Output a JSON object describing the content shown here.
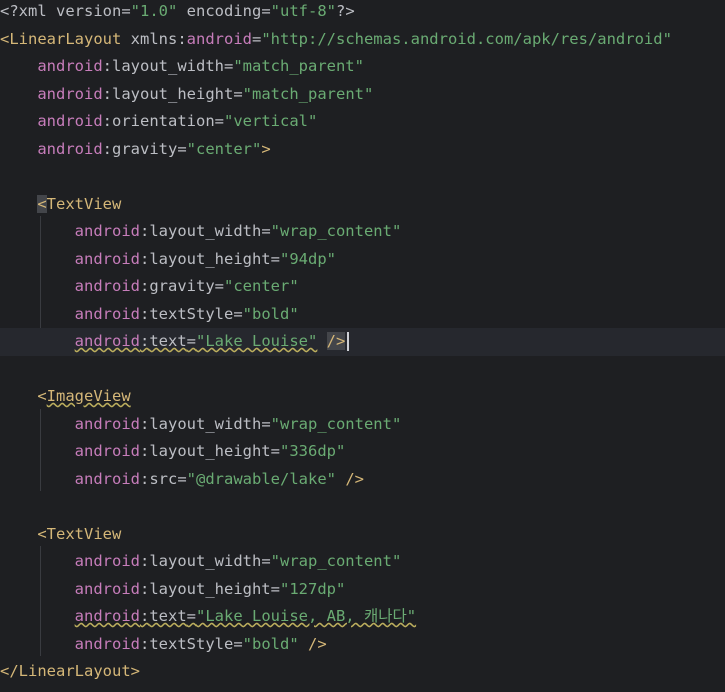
{
  "editor": {
    "lines": [
      {
        "parts": [
          [
            "punct",
            "<?xml version="
          ],
          [
            "val",
            "\"1.0\""
          ],
          [
            "punct",
            " encoding="
          ],
          [
            "val",
            "\"utf-8\""
          ],
          [
            "punct",
            "?>"
          ]
        ]
      },
      {
        "parts": [
          [
            "tag",
            "<LinearLayout"
          ],
          [
            "punct",
            " xmlns:"
          ],
          [
            "attr-ns",
            "android"
          ],
          [
            "punct",
            "="
          ],
          [
            "val",
            "\"http://schemas.android.com/apk/res/android\""
          ]
        ]
      },
      {
        "parts": [
          [
            "indent",
            "    "
          ],
          [
            "attr-ns",
            "android"
          ],
          [
            "punct",
            ":"
          ],
          [
            "attr",
            "layout_width"
          ],
          [
            "punct",
            "="
          ],
          [
            "val",
            "\"match_parent\""
          ]
        ]
      },
      {
        "parts": [
          [
            "indent",
            "    "
          ],
          [
            "attr-ns",
            "android"
          ],
          [
            "punct",
            ":"
          ],
          [
            "attr",
            "layout_height"
          ],
          [
            "punct",
            "="
          ],
          [
            "val",
            "\"match_parent\""
          ]
        ]
      },
      {
        "parts": [
          [
            "indent",
            "    "
          ],
          [
            "attr-ns",
            "android"
          ],
          [
            "punct",
            ":"
          ],
          [
            "attr",
            "orientation"
          ],
          [
            "punct",
            "="
          ],
          [
            "val",
            "\"vertical\""
          ]
        ]
      },
      {
        "parts": [
          [
            "indent",
            "    "
          ],
          [
            "attr-ns",
            "android"
          ],
          [
            "punct",
            ":"
          ],
          [
            "attr",
            "gravity"
          ],
          [
            "punct",
            "="
          ],
          [
            "val",
            "\"center\""
          ],
          [
            "tag",
            ">"
          ]
        ]
      },
      {
        "parts": []
      },
      {
        "parts": [
          [
            "indent",
            "    "
          ],
          [
            "tag-hl",
            "<"
          ],
          [
            "tag",
            "TextView"
          ]
        ]
      },
      {
        "parts": [
          [
            "indent",
            "        "
          ],
          [
            "attr-ns",
            "android"
          ],
          [
            "punct",
            ":"
          ],
          [
            "attr",
            "layout_width"
          ],
          [
            "punct",
            "="
          ],
          [
            "val",
            "\"wrap_content\""
          ]
        ]
      },
      {
        "parts": [
          [
            "indent",
            "        "
          ],
          [
            "attr-ns",
            "android"
          ],
          [
            "punct",
            ":"
          ],
          [
            "attr",
            "layout_height"
          ],
          [
            "punct",
            "="
          ],
          [
            "val",
            "\"94dp\""
          ]
        ]
      },
      {
        "parts": [
          [
            "indent",
            "        "
          ],
          [
            "attr-ns",
            "android"
          ],
          [
            "punct",
            ":"
          ],
          [
            "attr",
            "gravity"
          ],
          [
            "punct",
            "="
          ],
          [
            "val",
            "\"center\""
          ]
        ]
      },
      {
        "parts": [
          [
            "indent",
            "        "
          ],
          [
            "attr-ns",
            "android"
          ],
          [
            "punct",
            ":"
          ],
          [
            "attr",
            "textStyle"
          ],
          [
            "punct",
            "="
          ],
          [
            "val",
            "\"bold\""
          ]
        ]
      },
      {
        "current": true,
        "parts": [
          [
            "indent",
            "        "
          ],
          [
            "attr-ns-ul",
            "android"
          ],
          [
            "punct-ul",
            ":"
          ],
          [
            "attr-ul",
            "text"
          ],
          [
            "punct-ul",
            "="
          ],
          [
            "val-ul",
            "\"Lake Louise\""
          ],
          [
            "punct",
            " "
          ],
          [
            "tag-hl",
            "/>"
          ],
          [
            "caret",
            ""
          ]
        ]
      },
      {
        "parts": []
      },
      {
        "parts": [
          [
            "indent",
            "    "
          ],
          [
            "tag",
            "<"
          ],
          [
            "tag-ul",
            "ImageView"
          ]
        ]
      },
      {
        "parts": [
          [
            "indent",
            "        "
          ],
          [
            "attr-ns",
            "android"
          ],
          [
            "punct",
            ":"
          ],
          [
            "attr",
            "layout_width"
          ],
          [
            "punct",
            "="
          ],
          [
            "val",
            "\"wrap_content\""
          ]
        ]
      },
      {
        "parts": [
          [
            "indent",
            "        "
          ],
          [
            "attr-ns",
            "android"
          ],
          [
            "punct",
            ":"
          ],
          [
            "attr",
            "layout_height"
          ],
          [
            "punct",
            "="
          ],
          [
            "val",
            "\"336dp\""
          ]
        ]
      },
      {
        "parts": [
          [
            "indent",
            "        "
          ],
          [
            "attr-ns",
            "android"
          ],
          [
            "punct",
            ":"
          ],
          [
            "attr",
            "src"
          ],
          [
            "punct",
            "="
          ],
          [
            "val",
            "\"@drawable/lake\""
          ],
          [
            "punct",
            " "
          ],
          [
            "tag",
            "/>"
          ]
        ]
      },
      {
        "parts": []
      },
      {
        "parts": [
          [
            "indent",
            "    "
          ],
          [
            "tag",
            "<TextView"
          ]
        ]
      },
      {
        "parts": [
          [
            "indent",
            "        "
          ],
          [
            "attr-ns",
            "android"
          ],
          [
            "punct",
            ":"
          ],
          [
            "attr",
            "layout_width"
          ],
          [
            "punct",
            "="
          ],
          [
            "val",
            "\"wrap_content\""
          ]
        ]
      },
      {
        "parts": [
          [
            "indent",
            "        "
          ],
          [
            "attr-ns",
            "android"
          ],
          [
            "punct",
            ":"
          ],
          [
            "attr",
            "layout_height"
          ],
          [
            "punct",
            "="
          ],
          [
            "val",
            "\"127dp\""
          ]
        ]
      },
      {
        "parts": [
          [
            "indent",
            "        "
          ],
          [
            "attr-ns-ul",
            "android"
          ],
          [
            "punct-ul",
            ":"
          ],
          [
            "attr-ul",
            "text"
          ],
          [
            "punct-ul",
            "="
          ],
          [
            "val-ul",
            "\"Lake Louise, AB, 캐나다\""
          ]
        ]
      },
      {
        "parts": [
          [
            "indent",
            "        "
          ],
          [
            "attr-ns",
            "android"
          ],
          [
            "punct",
            ":"
          ],
          [
            "attr",
            "textStyle"
          ],
          [
            "punct",
            "="
          ],
          [
            "val",
            "\"bold\""
          ],
          [
            "punct",
            " "
          ],
          [
            "tag",
            "/>"
          ]
        ]
      },
      {
        "parts": [
          [
            "tag",
            "</LinearLayout>"
          ]
        ]
      }
    ]
  }
}
